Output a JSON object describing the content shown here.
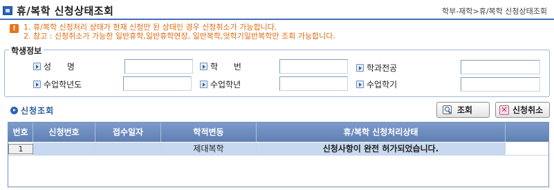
{
  "header": {
    "title": "휴/복학 신청상태조회",
    "breadcrumb": "학부-재학>휴/복학 신청상태조회"
  },
  "notice": {
    "icon": "exclamation-icon",
    "lines": [
      "1. 휴/복학 신청처리 상태가 현재 신청만 된 상태인 경우 신청취소가 가능합니다.",
      "2. 참고 : 신청취소가 가능한 일반휴학,일반휴학연장, 일반복학,엇학기일반복학만 조회 가능합니다."
    ]
  },
  "student_info": {
    "legend": "학생정보",
    "fields": [
      {
        "label": "성      명",
        "value": ""
      },
      {
        "label": "학      번",
        "value": ""
      },
      {
        "label": "학과전공",
        "value": ""
      },
      {
        "label": "수업학년도",
        "value": ""
      },
      {
        "label": "수업학년",
        "value": ""
      },
      {
        "label": "수업학기",
        "value": ""
      }
    ]
  },
  "section": {
    "title": "신청조회"
  },
  "buttons": {
    "search": "조회",
    "cancel": "신청취소"
  },
  "grid": {
    "columns": [
      "번호",
      "신청번호",
      "접수일자",
      "학적변동",
      "휴/복학 신청처리상태"
    ],
    "rows": [
      {
        "no": "1",
        "apply_no": "",
        "date": "",
        "change": "제대복학",
        "status": "신청사항이 완전 허가되었습니다."
      }
    ]
  },
  "colors": {
    "accent": "#2a63b8",
    "notice_text": "#e06a10",
    "grid_header": "#6e8ec0",
    "selected_cell": "#c8d9ef"
  }
}
